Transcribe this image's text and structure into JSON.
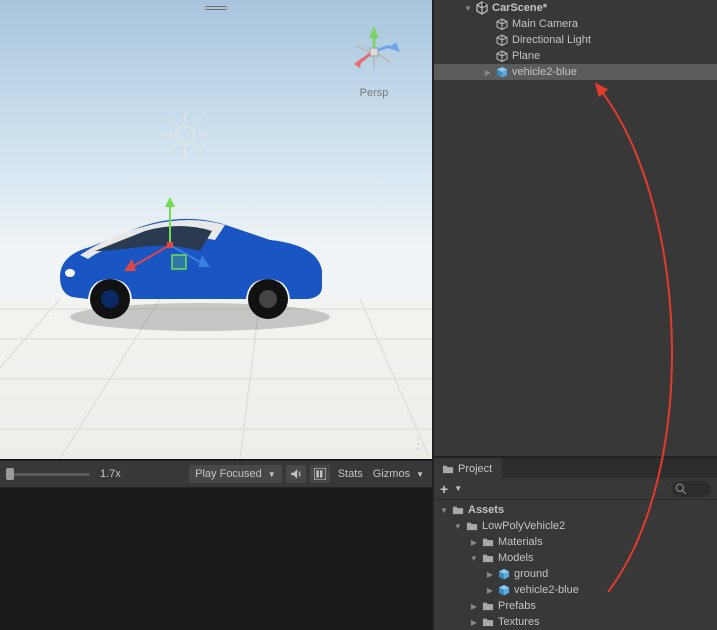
{
  "hierarchy": {
    "scene_name": "CarScene*",
    "items": [
      {
        "label": "Main Camera"
      },
      {
        "label": "Directional Light"
      },
      {
        "label": "Plane"
      },
      {
        "label": "vehicle2-blue",
        "prefab": true,
        "highlighted": true,
        "hasChildren": true
      }
    ]
  },
  "view_gizmo": {
    "mode": "Persp"
  },
  "toolbar": {
    "zoom_value": "1.7x",
    "play_mode_label": "Play Focused",
    "stats_label": "Stats",
    "gizmos_label": "Gizmos"
  },
  "project": {
    "tab_label": "Project",
    "add_label": "+",
    "root": "Assets",
    "tree": {
      "assets": {
        "label": "Assets",
        "children": {
          "lowpoly": {
            "label": "LowPolyVehicle2",
            "children": {
              "materials": {
                "label": "Materials"
              },
              "models": {
                "label": "Models",
                "children": {
                  "ground": {
                    "label": "ground"
                  },
                  "vehicle": {
                    "label": "vehicle2-blue"
                  }
                }
              },
              "prefabs": {
                "label": "Prefabs"
              },
              "textures": {
                "label": "Textures"
              }
            }
          }
        }
      }
    }
  }
}
